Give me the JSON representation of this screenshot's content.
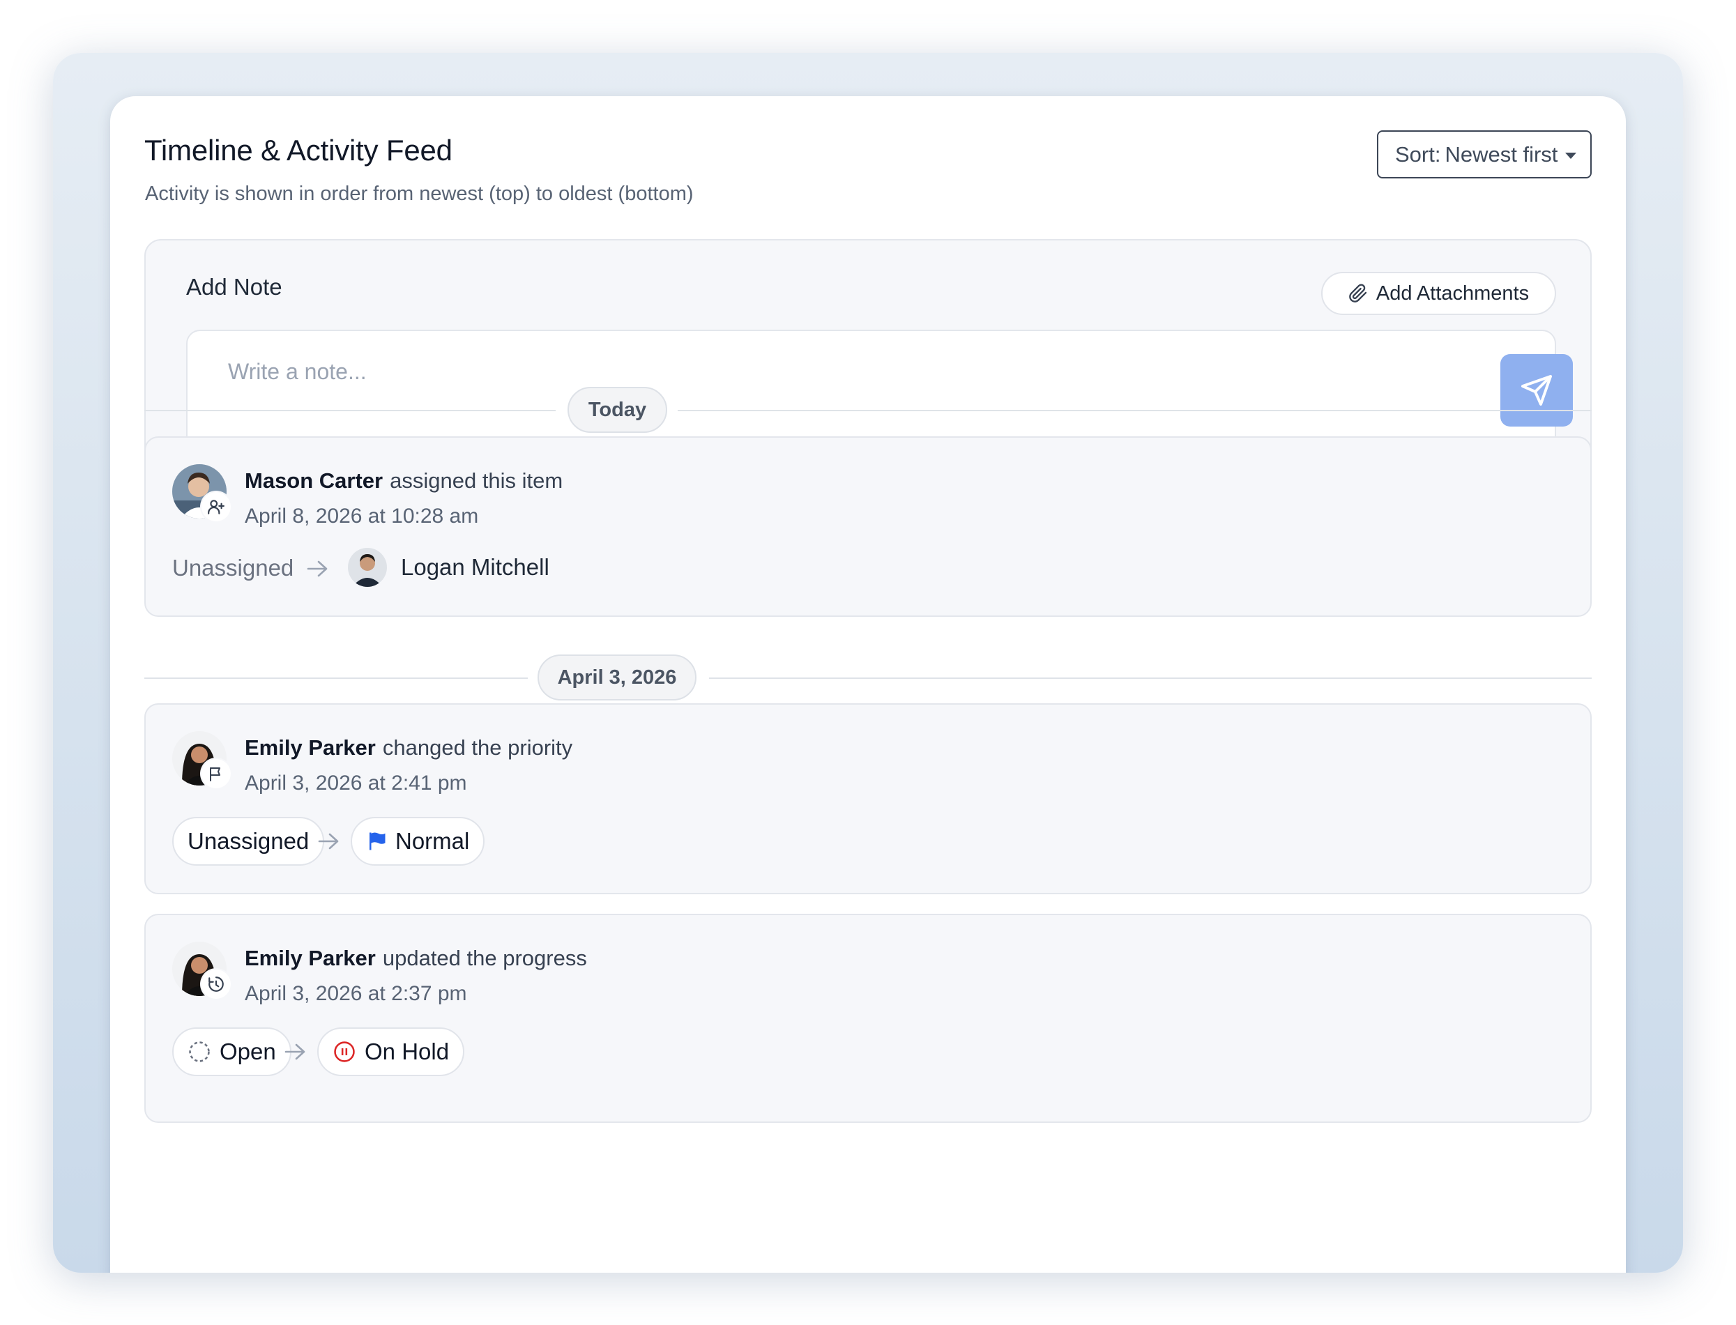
{
  "header": {
    "title": "Timeline & Activity Feed",
    "subtitle": "Activity is shown in order from newest (top) to oldest (bottom)"
  },
  "sort": {
    "label": "Sort:",
    "value": "Newest first"
  },
  "note": {
    "title": "Add Note",
    "attach_label": "Add Attachments",
    "placeholder": "Write a note..."
  },
  "groups": [
    {
      "date_label": "Today",
      "events": [
        {
          "actor": "Mason Carter",
          "action": "assigned this item",
          "time": "April 8, 2026 at 10:28 am",
          "badge_icon": "user-plus-icon",
          "from": "Unassigned",
          "to": "Logan Mitchell"
        }
      ]
    },
    {
      "date_label": "April 3, 2026",
      "events": [
        {
          "actor": "Emily Parker",
          "action": "changed the priority",
          "time": "April 3, 2026 at 2:41 pm",
          "badge_icon": "flag-icon",
          "from": "Unassigned",
          "to": "Normal",
          "to_color": "#2563eb"
        },
        {
          "actor": "Emily Parker",
          "action": "updated the progress",
          "time": "April 3, 2026 at 2:37 pm",
          "badge_icon": "clock-icon",
          "from": "Open",
          "to": "On Hold",
          "to_color": "#dc2626"
        }
      ]
    }
  ]
}
